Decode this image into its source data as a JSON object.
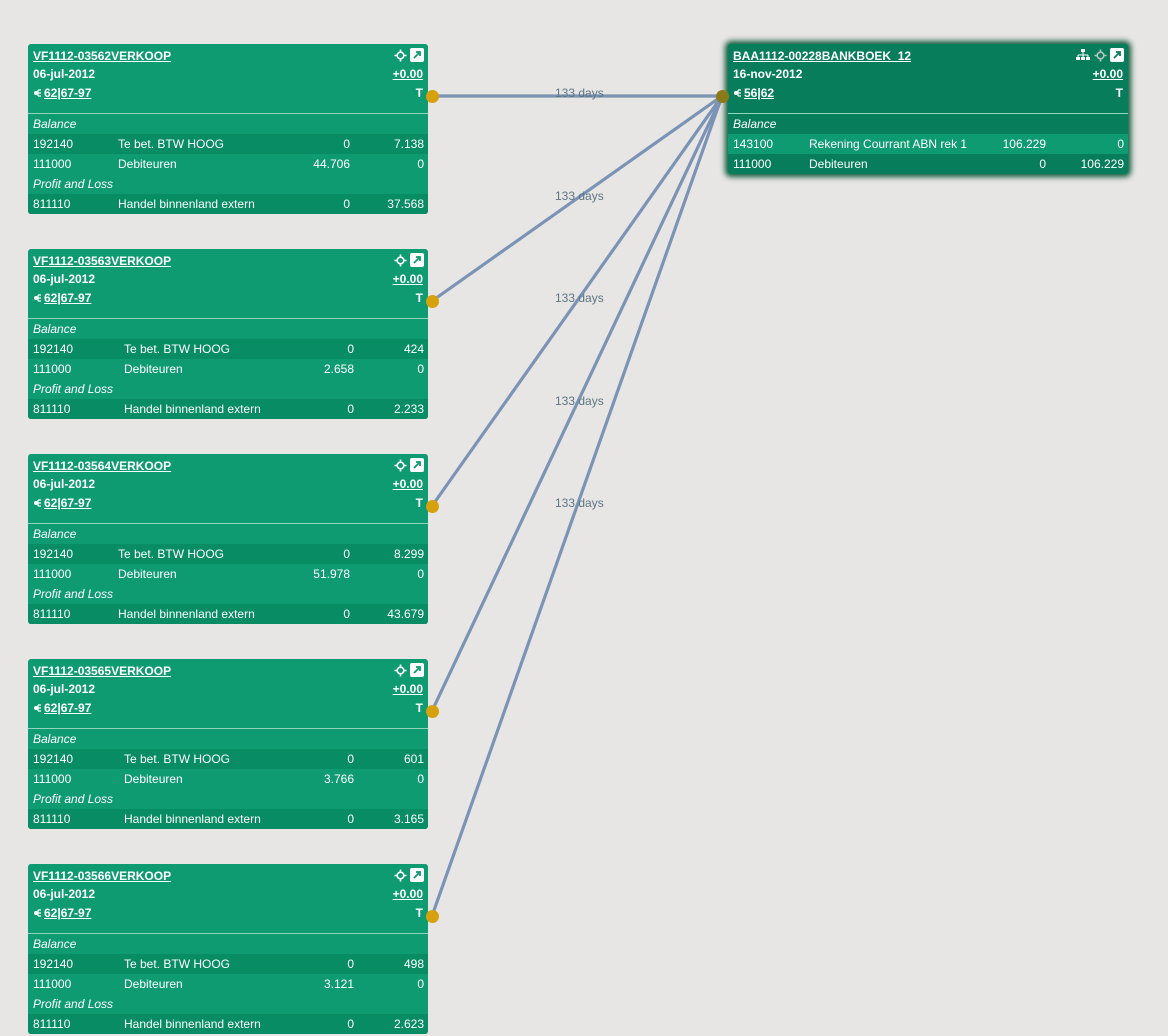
{
  "link_label": "133 days",
  "target": {
    "title": "BAA1112-00228BANKBOEK_12",
    "date": "16-nov-2012",
    "refs": "56|62",
    "amount": "+0.00",
    "t": "T",
    "balance_label": "Balance",
    "balance_rows": [
      {
        "account": "143100",
        "name": "Rekening Courrant ABN rek 1",
        "debit": "106.229",
        "credit": "0"
      },
      {
        "account": "111000",
        "name": "Debiteuren",
        "debit": "0",
        "credit": "106.229"
      }
    ]
  },
  "cards": [
    {
      "title": "VF1112-03562VERKOOP",
      "date": "06-jul-2012",
      "refs": "62|67-97",
      "amount": "+0.00",
      "t": "T",
      "balance_label": "Balance",
      "balance_rows": [
        {
          "account": "192140",
          "name": "Te bet. BTW HOOG",
          "debit": "0",
          "credit": "7.138"
        },
        {
          "account": "111000",
          "name": "Debiteuren",
          "debit": "44.706",
          "credit": "0"
        }
      ],
      "pl_label": "Profit and Loss",
      "pl_rows": [
        {
          "account": "811110",
          "name": "Handel binnenland extern",
          "debit": "0",
          "credit": "37.568"
        }
      ]
    },
    {
      "title": "VF1112-03563VERKOOP",
      "date": "06-jul-2012",
      "refs": "62|67-97",
      "amount": "+0.00",
      "t": "T",
      "balance_label": "Balance",
      "balance_rows": [
        {
          "account": "192140",
          "name": "Te bet. BTW HOOG",
          "debit": "0",
          "credit": "424"
        },
        {
          "account": "111000",
          "name": "Debiteuren",
          "debit": "2.658",
          "credit": "0"
        }
      ],
      "pl_label": "Profit and Loss",
      "pl_rows": [
        {
          "account": "811110",
          "name": "Handel binnenland extern",
          "debit": "0",
          "credit": "2.233"
        }
      ]
    },
    {
      "title": "VF1112-03564VERKOOP",
      "date": "06-jul-2012",
      "refs": "62|67-97",
      "amount": "+0.00",
      "t": "T",
      "balance_label": "Balance",
      "balance_rows": [
        {
          "account": "192140",
          "name": "Te bet. BTW HOOG",
          "debit": "0",
          "credit": "8.299"
        },
        {
          "account": "111000",
          "name": "Debiteuren",
          "debit": "51.978",
          "credit": "0"
        }
      ],
      "pl_label": "Profit and Loss",
      "pl_rows": [
        {
          "account": "811110",
          "name": "Handel binnenland extern",
          "debit": "0",
          "credit": "43.679"
        }
      ]
    },
    {
      "title": "VF1112-03565VERKOOP",
      "date": "06-jul-2012",
      "refs": "62|67-97",
      "amount": "+0.00",
      "t": "T",
      "balance_label": "Balance",
      "balance_rows": [
        {
          "account": "192140",
          "name": "Te bet. BTW HOOG",
          "debit": "0",
          "credit": "601"
        },
        {
          "account": "111000",
          "name": "Debiteuren",
          "debit": "3.766",
          "credit": "0"
        }
      ],
      "pl_label": "Profit and Loss",
      "pl_rows": [
        {
          "account": "811110",
          "name": "Handel binnenland extern",
          "debit": "0",
          "credit": "3.165"
        }
      ]
    },
    {
      "title": "VF1112-03566VERKOOP",
      "date": "06-jul-2012",
      "refs": "62|67-97",
      "amount": "+0.00",
      "t": "T",
      "balance_label": "Balance",
      "balance_rows": [
        {
          "account": "192140",
          "name": "Te bet. BTW HOOG",
          "debit": "0",
          "credit": "498"
        },
        {
          "account": "111000",
          "name": "Debiteuren",
          "debit": "3.121",
          "credit": "0"
        }
      ],
      "pl_label": "Profit and Loss",
      "pl_rows": [
        {
          "account": "811110",
          "name": "Handel binnenland extern",
          "debit": "0",
          "credit": "2.623"
        }
      ]
    }
  ],
  "colors": {
    "card": "#0f9b72",
    "target_card": "#087d5b",
    "link": "#7b93b5",
    "anchor": "#d6a10d",
    "background": "#e8e6e5"
  },
  "icons": [
    "move-icon",
    "open-external-icon",
    "hierarchy-icon",
    "reference-icon"
  ]
}
